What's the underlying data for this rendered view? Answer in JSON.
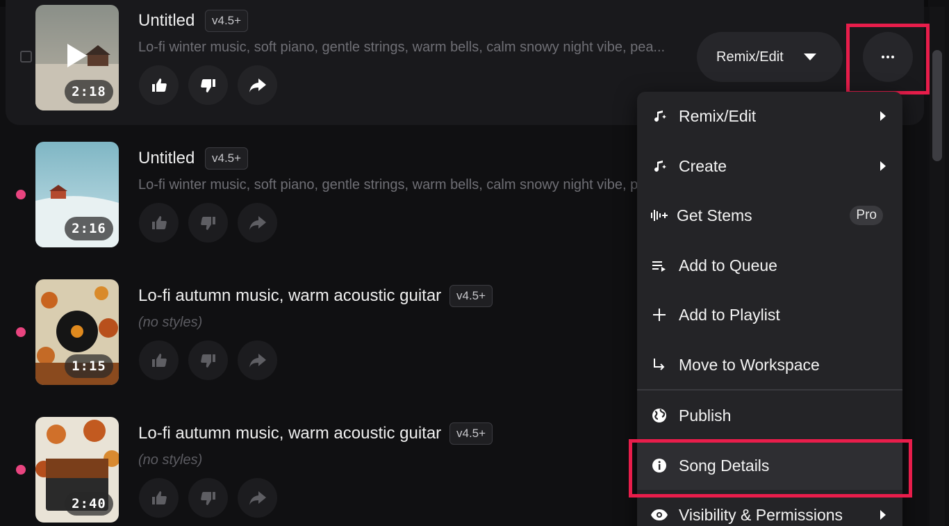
{
  "songs": [
    {
      "title": "Untitled",
      "version": "v4.5+",
      "styles": "Lo-fi winter music, soft piano, gentle strings, warm bells, calm snowy night vibe, pea...",
      "duration": "2:18"
    },
    {
      "title": "Untitled",
      "version": "v4.5+",
      "styles": "Lo-fi winter music, soft piano, gentle strings, warm bells, calm snowy night vibe, p",
      "duration": "2:16"
    },
    {
      "title": "Lo-fi autumn music, warm acoustic guitar",
      "version": "v4.5+",
      "styles": "(no styles)",
      "duration": "1:15"
    },
    {
      "title": "Lo-fi autumn music, warm acoustic guitar",
      "version": "v4.5+",
      "styles": "(no styles)",
      "duration": "2:40"
    }
  ],
  "row_actions": {
    "remix_label": "Remix/Edit"
  },
  "menu": {
    "items": [
      {
        "label": "Remix/Edit",
        "icon": "music-sparkle-icon",
        "submenu": true
      },
      {
        "label": "Create",
        "icon": "music-sparkle-icon",
        "submenu": true
      },
      {
        "label": "Get Stems",
        "icon": "waveform-plus-icon",
        "badge": "Pro"
      },
      {
        "label": "Add to Queue",
        "icon": "queue-icon"
      },
      {
        "label": "Add to Playlist",
        "icon": "plus-icon"
      },
      {
        "label": "Move to Workspace",
        "icon": "arrow-down-right-icon"
      },
      {
        "label": "Publish",
        "icon": "globe-icon"
      },
      {
        "label": "Song Details",
        "icon": "info-icon"
      },
      {
        "label": "Visibility & Permissions",
        "icon": "eye-icon",
        "submenu": true
      }
    ]
  },
  "colors": {
    "accent_dot": "#e8447f",
    "highlight": "#e81d4b",
    "background": "#101012",
    "menu": "#242427"
  }
}
